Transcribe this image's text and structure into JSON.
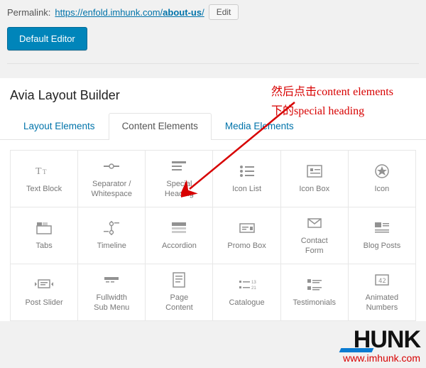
{
  "permalink": {
    "label": "Permalink:",
    "base": "https://enfold.imhunk.com/",
    "slug": "about-us",
    "trail": "/",
    "edit": "Edit"
  },
  "buttons": {
    "default_editor": "Default Editor"
  },
  "panel": {
    "title": "Avia Layout Builder"
  },
  "tabs": [
    {
      "label": "Layout Elements",
      "active": false
    },
    {
      "label": "Content Elements",
      "active": true
    },
    {
      "label": "Media Elements",
      "active": false
    }
  ],
  "elements": [
    {
      "label": "Text Block",
      "icon": "text"
    },
    {
      "label": "Separator /\nWhitespace",
      "icon": "separator"
    },
    {
      "label": "Special\nHeading",
      "icon": "heading"
    },
    {
      "label": "Icon List",
      "icon": "iconlist"
    },
    {
      "label": "Icon Box",
      "icon": "iconbox"
    },
    {
      "label": "Icon",
      "icon": "icon"
    },
    {
      "label": "Tabs",
      "icon": "tabs"
    },
    {
      "label": "Timeline",
      "icon": "timeline"
    },
    {
      "label": "Accordion",
      "icon": "accordion"
    },
    {
      "label": "Promo Box",
      "icon": "promo"
    },
    {
      "label": "Contact\nForm",
      "icon": "contact"
    },
    {
      "label": "Blog Posts",
      "icon": "blog"
    },
    {
      "label": "Post Slider",
      "icon": "postslider"
    },
    {
      "label": "Fullwidth\nSub Menu",
      "icon": "submenu"
    },
    {
      "label": "Page\nContent",
      "icon": "pagecontent"
    },
    {
      "label": "Catalogue",
      "icon": "catalogue"
    },
    {
      "label": "Testimonials",
      "icon": "testimonials"
    },
    {
      "label": "Animated\nNumbers",
      "icon": "numbers"
    }
  ],
  "annotation": {
    "line1": "然后点击content elements",
    "line2": "下的special heading"
  },
  "watermark": {
    "brand": "HUNK",
    "url": "www.imhunk.com"
  }
}
